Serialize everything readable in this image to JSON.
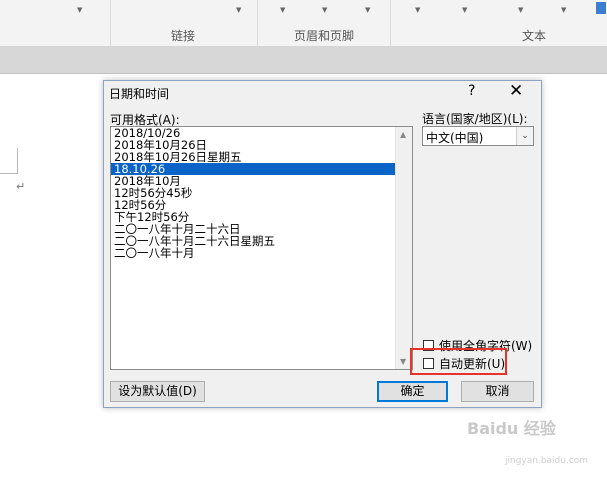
{
  "ribbon": {
    "group_links": "链接",
    "group_header_footer": "页眉和页脚",
    "group_text": "文本"
  },
  "dialog": {
    "title": "日期和时间",
    "help": "?",
    "close": "✕",
    "formats_label": "可用格式(A):",
    "formats": [
      "2018/10/26",
      "2018年10月26日",
      "2018年10月26日星期五",
      "18.10.26",
      "2018年10月",
      "12时56分45秒",
      "12时56分",
      "下午12时56分",
      "二〇一八年十月二十六日",
      "二〇一八年十月二十六日星期五",
      "二〇一八年十月"
    ],
    "selected_index": 3,
    "language_label": "语言(国家/地区)(L):",
    "language_value": "中文(中国)",
    "fullwidth_label": "使用全角字符(W)",
    "fullwidth_checked": false,
    "autoupdate_label": "自动更新(U)",
    "autoupdate_checked": false,
    "set_default_label": "设为默认值(D)",
    "ok_label": "确定",
    "cancel_label": "取消"
  },
  "watermark": {
    "text": "Baidu 经验",
    "url": "jingyan.baidu.com"
  },
  "colors": {
    "selection": "#0a64c8",
    "highlight_box": "#e8322c",
    "default_button_border": "#0078d7"
  }
}
